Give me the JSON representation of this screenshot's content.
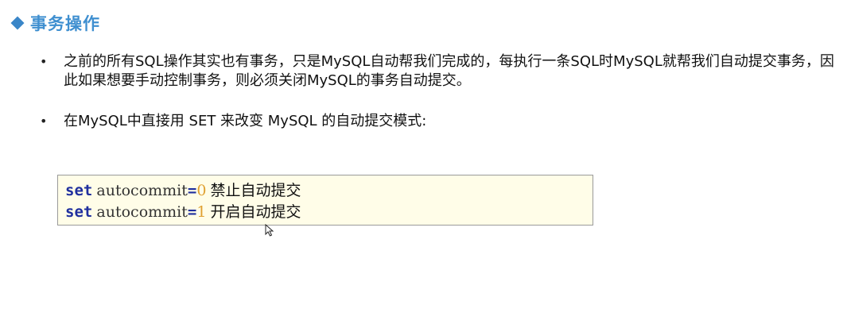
{
  "slide": {
    "title": "事务操作",
    "bullets": [
      "之前的所有SQL操作其实也有事务，只是MySQL自动帮我们完成的，每执行一条SQL时MySQL就帮我们自动提交事务，因此如果想要手动控制事务，则必须关闭MySQL的事务自动提交。",
      "在MySQL中直接用 SET 来改变 MySQL 的自动提交模式:"
    ],
    "bullet_glyph": "•",
    "code_lines": [
      {
        "keyword": "set",
        "ident": "autocommit",
        "op": "=",
        "value": "0",
        "comment": "禁止自动提交"
      },
      {
        "keyword": "set",
        "ident": "autocommit",
        "op": "=",
        "value": "1",
        "comment": "开启自动提交"
      }
    ]
  },
  "colors": {
    "title": "#3f8fd0",
    "diamond": "#3a86c8",
    "keyword": "#1f2f9e",
    "number": "#e0a030",
    "code_bg": "#fffde8"
  },
  "icons": {
    "title_marker": "diamond-icon",
    "pointer": "mouse-pointer-icon"
  }
}
